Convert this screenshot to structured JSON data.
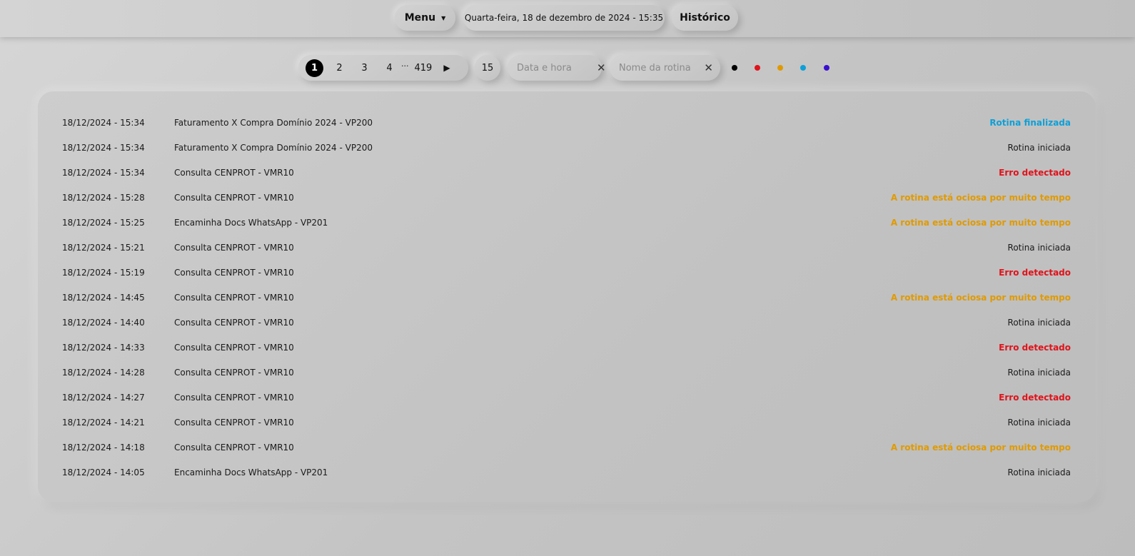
{
  "header": {
    "menu_label": "Menu",
    "menu_caret": "▼",
    "datetime": "Quarta-feira, 18 de dezembro de 2024 - 15:35",
    "history_label": "Histórico"
  },
  "pagination": {
    "pages": [
      "1",
      "2",
      "3",
      "4"
    ],
    "active_page": "1",
    "ellipsis": "···",
    "last_page": "419",
    "next_symbol": "▶"
  },
  "per_page": "15",
  "filters": {
    "date_placeholder": "Data e hora",
    "name_placeholder": "Nome da rotina",
    "clear_symbol": "✕"
  },
  "status_colors": [
    {
      "name": "black",
      "color": "#000000"
    },
    {
      "name": "red",
      "color": "#e0131b"
    },
    {
      "name": "orange",
      "color": "#e09a00"
    },
    {
      "name": "blue",
      "color": "#0da0d8"
    },
    {
      "name": "purple",
      "color": "#3a0fd0"
    }
  ],
  "logs": [
    {
      "timestamp": "18/12/2024 - 15:34",
      "routine": "Faturamento X Compra Domínio 2024 - VP200",
      "status": "Rotina finalizada",
      "status_type": "blue"
    },
    {
      "timestamp": "18/12/2024 - 15:34",
      "routine": "Faturamento X Compra Domínio 2024 - VP200",
      "status": "Rotina iniciada",
      "status_type": "normal"
    },
    {
      "timestamp": "18/12/2024 - 15:34",
      "routine": "Consulta CENPROT - VMR10",
      "status": "Erro detectado",
      "status_type": "red"
    },
    {
      "timestamp": "18/12/2024 - 15:28",
      "routine": "Consulta CENPROT - VMR10",
      "status": "A rotina está ociosa por muito tempo",
      "status_type": "orange"
    },
    {
      "timestamp": "18/12/2024 - 15:25",
      "routine": "Encaminha Docs WhatsApp - VP201",
      "status": "A rotina está ociosa por muito tempo",
      "status_type": "orange"
    },
    {
      "timestamp": "18/12/2024 - 15:21",
      "routine": "Consulta CENPROT - VMR10",
      "status": "Rotina iniciada",
      "status_type": "normal"
    },
    {
      "timestamp": "18/12/2024 - 15:19",
      "routine": "Consulta CENPROT - VMR10",
      "status": "Erro detectado",
      "status_type": "red"
    },
    {
      "timestamp": "18/12/2024 - 14:45",
      "routine": "Consulta CENPROT - VMR10",
      "status": "A rotina está ociosa por muito tempo",
      "status_type": "orange"
    },
    {
      "timestamp": "18/12/2024 - 14:40",
      "routine": "Consulta CENPROT - VMR10",
      "status": "Rotina iniciada",
      "status_type": "normal"
    },
    {
      "timestamp": "18/12/2024 - 14:33",
      "routine": "Consulta CENPROT - VMR10",
      "status": "Erro detectado",
      "status_type": "red"
    },
    {
      "timestamp": "18/12/2024 - 14:28",
      "routine": "Consulta CENPROT - VMR10",
      "status": "Rotina iniciada",
      "status_type": "normal"
    },
    {
      "timestamp": "18/12/2024 - 14:27",
      "routine": "Consulta CENPROT - VMR10",
      "status": "Erro detectado",
      "status_type": "red"
    },
    {
      "timestamp": "18/12/2024 - 14:21",
      "routine": "Consulta CENPROT - VMR10",
      "status": "Rotina iniciada",
      "status_type": "normal"
    },
    {
      "timestamp": "18/12/2024 - 14:18",
      "routine": "Consulta CENPROT - VMR10",
      "status": "A rotina está ociosa por muito tempo",
      "status_type": "orange"
    },
    {
      "timestamp": "18/12/2024 - 14:05",
      "routine": "Encaminha Docs WhatsApp - VP201",
      "status": "Rotina iniciada",
      "status_type": "normal"
    }
  ]
}
